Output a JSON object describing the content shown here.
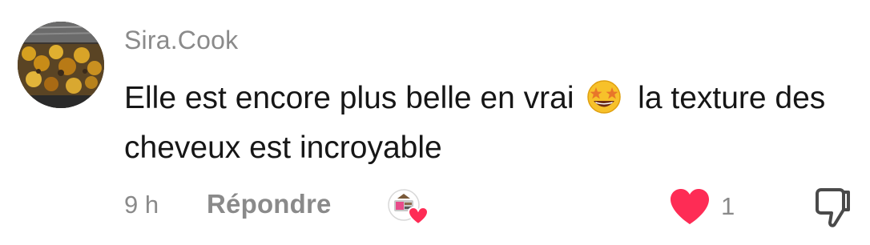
{
  "comment": {
    "username": "Sira.Cook",
    "text_before_emoji": "Elle est encore plus belle en vrai",
    "text_after_emoji": "la texture des cheveux est incroyable",
    "emoji": "star-struck-emoji",
    "time": "9 h",
    "reply_label": "Répondre",
    "like_count": "1",
    "liked": true,
    "liked_by_creator": true
  },
  "colors": {
    "text": "#161616",
    "muted": "#8a8a8a",
    "like": "#fe2c55"
  },
  "icons": {
    "avatar": "food-tray-photo",
    "creator_badge": "creator-avatar-with-heart-icon",
    "like": "heart-icon",
    "dislike": "thumbs-down-icon"
  }
}
